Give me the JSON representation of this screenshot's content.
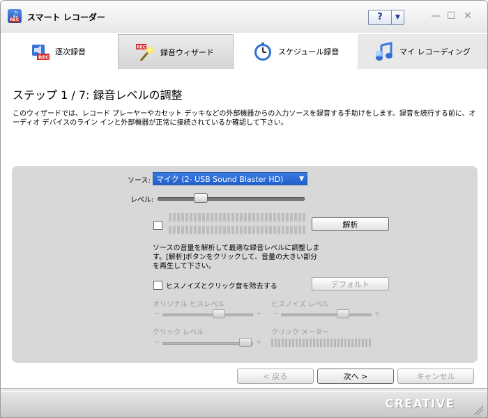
{
  "window": {
    "title": "スマート レコーダー"
  },
  "titlebar": {
    "help_label": "?",
    "help_dropdown": "▼",
    "minimize": "—",
    "maximize": "☐",
    "close": "✕"
  },
  "tabs": [
    {
      "label": "逐次録音",
      "icon": "rec-speaker-icon",
      "active": false
    },
    {
      "label": "録音ウィザード",
      "icon": "wand-icon",
      "active": true
    },
    {
      "label": "スケジュール録音",
      "icon": "clock-icon",
      "active": false
    },
    {
      "label": "マイ レコーディング",
      "icon": "music-note-icon",
      "active": false
    }
  ],
  "step": {
    "title": "ステップ 1 / 7: 録音レベルの調整",
    "description": "このウィザードでは、レコード プレーヤーやカセット デッキなどの外部機器からの入力ソースを録音する手助けをします。録音を続行する前に、オーディオ デバイスのライン インと外部機器が正常に接続されているか確認して下さい。"
  },
  "panel": {
    "source_label": "ソース:",
    "source_value": "マイク (2- USB Sound Blaster HD)",
    "level_label": "レベル:",
    "level_value": 0.27,
    "analyze_button": "解析",
    "analyze_text": "ソースの音量を解析して最適な録音レベルに調整します。[解析]ボタンをクリックして、音量の大きい部分を再生して下さい。",
    "noise_checkbox_label": "ヒスノイズとクリック音を除去する",
    "default_button": "デフォルト",
    "original_hiss_label": "オリジナル ヒスレベル",
    "hiss_noise_label": "ヒスノイズ レベル",
    "click_level_label": "クリック レベル",
    "click_meter_label": "クリック メーター",
    "minus": "−",
    "plus": "+"
  },
  "nav": {
    "back": "< 戻る",
    "next": "次へ >",
    "cancel": "キャンセル"
  },
  "footer": {
    "logo": "CREATIVE"
  }
}
